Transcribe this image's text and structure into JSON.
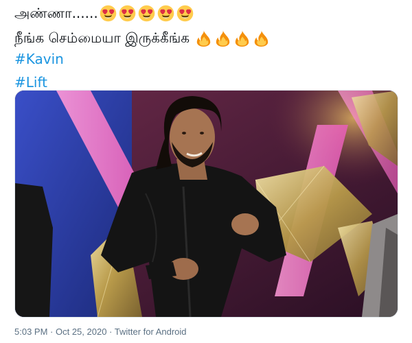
{
  "tweet": {
    "line1_text": "அண்ணா......",
    "line2_text": "நீங்க செம்மையா இருக்கீங்க",
    "line1_emojis": [
      "heart-eyes-emoji",
      "heart-eyes-emoji",
      "heart-eyes-emoji",
      "heart-eyes-emoji",
      "heart-eyes-emoji"
    ],
    "line2_emojis": [
      "fire-emoji",
      "fire-emoji",
      "fire-emoji",
      "fire-emoji"
    ],
    "hashtags": [
      "#Kavin",
      "#Lift"
    ]
  },
  "meta": {
    "time": "5:03 PM",
    "separator1": " · ",
    "date": "Oct 25, 2020",
    "separator2": " · ",
    "source": "Twitter for Android"
  },
  "colors": {
    "link": "#1b95e0",
    "meta": "#5b7083",
    "text": "#0f1419"
  }
}
